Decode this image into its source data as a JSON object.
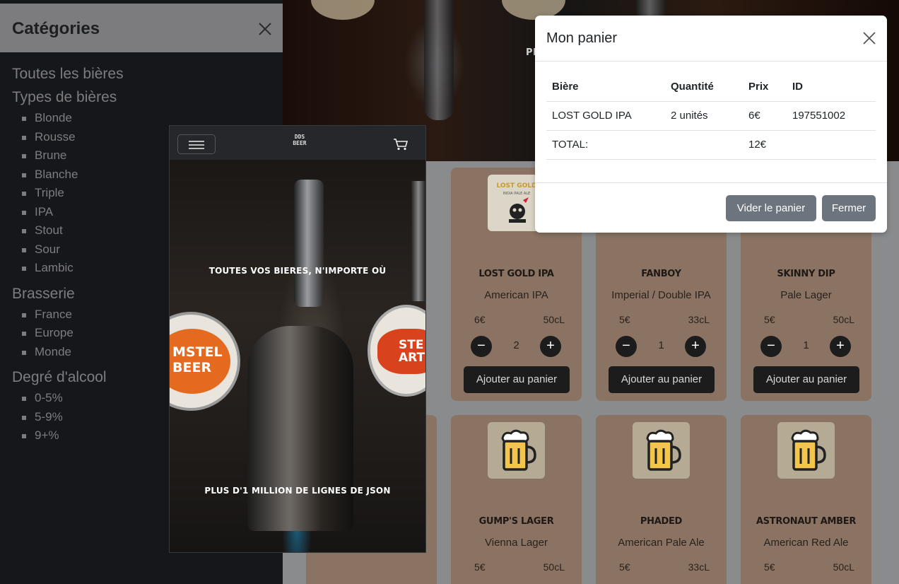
{
  "hero": {
    "text": "PL"
  },
  "sidebar": {
    "title": "Catégories",
    "all_beers": "Toutes les bières",
    "types_heading": "Types de bières",
    "types": [
      "Blonde",
      "Rousse",
      "Brune",
      "Blanche",
      "Triple",
      "IPA",
      "Stout",
      "Sour",
      "Lambic"
    ],
    "brewery_heading": "Brasserie",
    "breweries": [
      "France",
      "Europe",
      "Monde"
    ],
    "abv_heading": "Degré d'alcool",
    "abv": [
      "0-5%",
      "5-9%",
      "9+%"
    ]
  },
  "phone": {
    "logo": "DDS BEER",
    "tagline1": "TOUTES VOS BIERES, N'IMPORTE OÙ",
    "tagline2": "PLUS D'1 MILLION DE LIGNES DE JSON",
    "badge_left": "MSTEL BEER",
    "badge_right": "STE ART"
  },
  "products": [
    {
      "name": "LOST GOLD IPA",
      "style": "American IPA",
      "price": "6€",
      "volume": "50cL",
      "qty": "2",
      "add": "Ajouter au panier",
      "label": "LOST GOLD"
    },
    {
      "name": "FANBOY",
      "style": "Imperial / Double IPA",
      "price": "5€",
      "volume": "33cL",
      "qty": "1",
      "add": "Ajouter au panier"
    },
    {
      "name": "SKINNY DIP",
      "style": "Pale Lager",
      "price": "5€",
      "volume": "50cL",
      "qty": "1",
      "add": "Ajouter au panier"
    },
    {
      "name": "GUMP'S LAGER",
      "style": "Vienna Lager",
      "price": "5€",
      "volume": "50cL"
    },
    {
      "name": "PHADED",
      "style": "American Pale Ale",
      "price": "5€",
      "volume": "33cL"
    },
    {
      "name": "ASTRONAUT AMBER",
      "style": "American Red Ale",
      "price": "5€",
      "volume": "50cL"
    }
  ],
  "modal": {
    "title": "Mon panier",
    "columns": [
      "Bière",
      "Quantité",
      "Prix",
      "ID"
    ],
    "row": {
      "beer": "LOST GOLD IPA",
      "qty": "2 unités",
      "price": "6€",
      "id": "197551002"
    },
    "total_label": "TOTAL:",
    "total_value": "12€",
    "empty_btn": "Vider le panier",
    "close_btn": "Fermer"
  },
  "colors": {
    "card_bg": "#8b7363",
    "dark_btn": "#1c1c1c",
    "grey_btn": "#6c757d",
    "sidebar_bg": "#16171b"
  }
}
